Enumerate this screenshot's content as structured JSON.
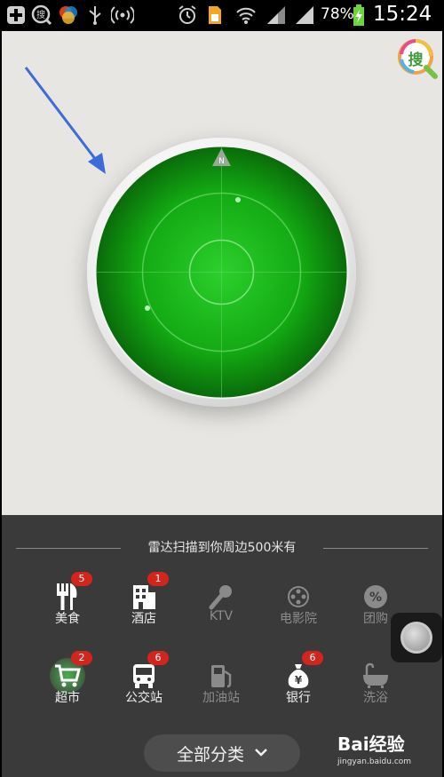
{
  "status_bar": {
    "icons": [
      "plus-icon",
      "search-circle-icon",
      "color-wheel-icon",
      "usb-icon",
      "wifi-hotspot-icon",
      "alarm-clock-icon",
      "sim-card-icon",
      "wifi-icon",
      "signal-icon",
      "signal-icon"
    ],
    "battery_percent": "78%",
    "time": "15:24"
  },
  "radar": {
    "compass_label": "N",
    "search_button_label": "搜",
    "accent_color": "#1fc51f"
  },
  "panel": {
    "title": "雷达扫描到你周边500米有",
    "categories": [
      {
        "label": "美食",
        "badge": "5",
        "icon": "fork-knife-icon",
        "enabled": true
      },
      {
        "label": "酒店",
        "badge": "1",
        "icon": "hotel-building-icon",
        "enabled": true
      },
      {
        "label": "KTV",
        "badge": "",
        "icon": "microphone-icon",
        "enabled": false
      },
      {
        "label": "电影院",
        "badge": "",
        "icon": "film-reel-icon",
        "enabled": false
      },
      {
        "label": "团购",
        "badge": "",
        "icon": "percent-tag-icon",
        "enabled": false
      },
      {
        "label": "超市",
        "badge": "2",
        "icon": "shopping-cart-icon",
        "enabled": true
      },
      {
        "label": "公交站",
        "badge": "6",
        "icon": "bus-icon",
        "enabled": true
      },
      {
        "label": "加油站",
        "badge": "",
        "icon": "gas-pump-icon",
        "enabled": false
      },
      {
        "label": "银行",
        "badge": "6",
        "icon": "money-bag-icon",
        "enabled": true
      },
      {
        "label": "洗浴",
        "badge": "",
        "icon": "bathtub-icon",
        "enabled": false
      }
    ],
    "all_categories_label": "全部分类",
    "all_categories_chevron": "⌄"
  },
  "watermark": {
    "brand": "Bai经验",
    "url": "jingyan.baidu.com"
  }
}
